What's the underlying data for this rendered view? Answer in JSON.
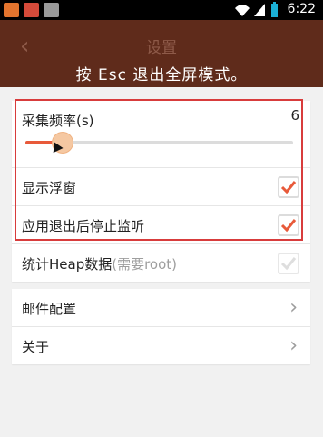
{
  "status_bar": {
    "time": "6:22"
  },
  "header": {
    "title": "设置",
    "back_icon": "‹",
    "fullscreen_notice": "按 Esc 退出全屏模式。"
  },
  "settings": {
    "sampling": {
      "label": "采集频率(s)",
      "value": "6",
      "slider_fraction": 0.14
    },
    "show_floating_window": {
      "label": "显示浮窗",
      "checked": true
    },
    "stop_monitor_on_exit": {
      "label": "应用退出后停止监听",
      "checked": true
    },
    "heap_stats": {
      "label": "统计Heap数据",
      "label_suffix": "(需要root)",
      "checked": true,
      "enabled": false
    }
  },
  "menu": {
    "mail_config": "邮件配置",
    "about": "关于",
    "chevron": "›"
  },
  "colors": {
    "accent": "#e85a3a",
    "highlight_border": "#d83c3c",
    "title_bar_bg": "#5f2b1b"
  }
}
